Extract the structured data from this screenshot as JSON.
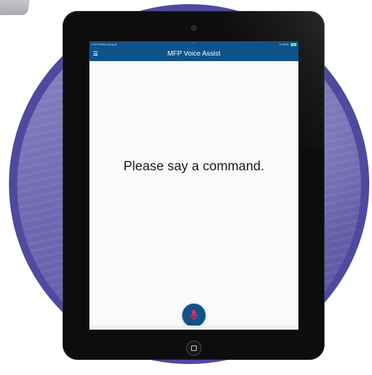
{
  "status_bar": {
    "time_date": "2:00 PM  Mon Aug 22",
    "center_indicator": "...",
    "right_status": "● 100%",
    "battery_icon": "battery-icon"
  },
  "app_bar": {
    "menu_icon": "hamburger-menu-icon",
    "title": "MFP Voice Assist"
  },
  "main": {
    "prompt": "Please say a command."
  },
  "mic_button": {
    "icon": "microphone-icon",
    "button_color": "#10538a",
    "icon_color": "#e8245f"
  },
  "colors": {
    "app_bar": "#10538a",
    "circle": "#4f4a9f",
    "tablet": "#0d0d0e"
  }
}
